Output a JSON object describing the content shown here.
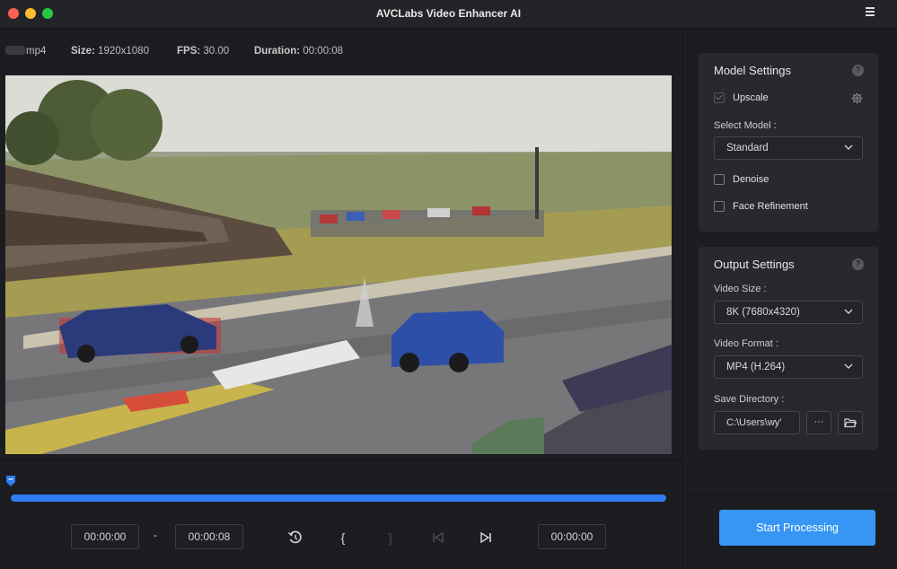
{
  "window": {
    "title": "AVCLabs Video Enhancer AI"
  },
  "file_info": {
    "filename_visible": "mp4",
    "size_label": "Size:",
    "size_value": "1920x1080",
    "fps_label": "FPS:",
    "fps_value": "30.00",
    "duration_label": "Duration:",
    "duration_value": "00:00:08"
  },
  "playback": {
    "progress_fraction": 1.0,
    "start_time": "00:00:00",
    "separator": "-",
    "end_time": "00:00:08",
    "current_time": "00:00:00"
  },
  "model_settings": {
    "title": "Model Settings",
    "upscale_label": "Upscale",
    "upscale_checked": true,
    "select_model_label": "Select Model :",
    "model_value": "Standard",
    "denoise_label": "Denoise",
    "denoise_checked": false,
    "face_label": "Face Refinement",
    "face_checked": false
  },
  "output_settings": {
    "title": "Output Settings",
    "video_size_label": "Video Size :",
    "video_size_value": "8K (7680x4320)",
    "video_format_label": "Video Format :",
    "video_format_value": "MP4 (H.264)",
    "save_dir_label": "Save Directory :",
    "save_dir_value": "C:\\Users\\wy'",
    "browse_label": "···"
  },
  "actions": {
    "start_label": "Start Processing"
  },
  "colors": {
    "accent": "#3796f4",
    "progress": "#2e7cf6",
    "background": "#1c1d21",
    "panel": "#28292e"
  }
}
